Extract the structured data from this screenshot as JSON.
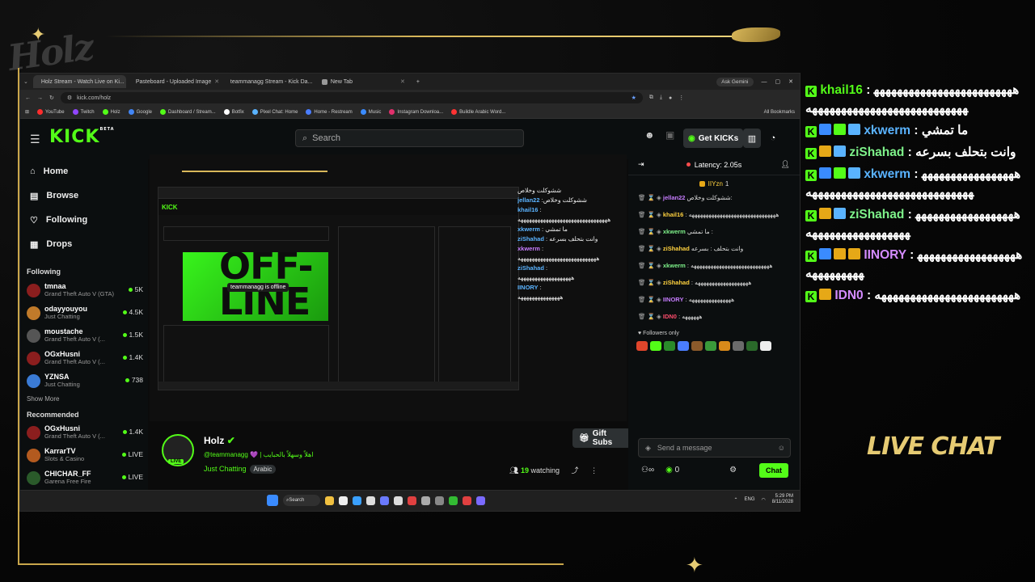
{
  "browser": {
    "tabs": [
      {
        "label": "Holz Stream - Watch Live on Ki...",
        "active": true,
        "color": "#53fc18"
      },
      {
        "label": "Pasteboard - Uploaded Image",
        "active": false,
        "color": "#6aa0ff"
      },
      {
        "label": "teammanagg Stream - Kick Da...",
        "active": false,
        "color": "#53fc18"
      },
      {
        "label": "New Tab",
        "active": false,
        "color": "#999999"
      }
    ],
    "ask_gemini": "Ask Gemini",
    "url": "kick.com/holz",
    "all_bookmarks": "All Bookmarks",
    "bookmarks": [
      {
        "label": "YouTube",
        "color": "#ff2d2d"
      },
      {
        "label": "Twitch",
        "color": "#9146ff"
      },
      {
        "label": "Holz",
        "color": "#53fc18"
      },
      {
        "label": "Google",
        "color": "#4285f4"
      },
      {
        "label": "Dashboard / Stream...",
        "color": "#53fc18"
      },
      {
        "label": "Botfix",
        "color": "#ffffff"
      },
      {
        "label": "Pixel Chat: Home",
        "color": "#5ab3ff"
      },
      {
        "label": "Home - Restream",
        "color": "#4a7dff"
      },
      {
        "label": "Music",
        "color": "#3a8bff"
      },
      {
        "label": "Instagram Downloa...",
        "color": "#e1306c"
      },
      {
        "label": "Buildle Arabic Word...",
        "color": "#ff3333"
      }
    ]
  },
  "kick": {
    "logo": "KICK",
    "beta": "BETA",
    "search_placeholder": "Search",
    "get_kicks": "Get KICKs",
    "nav": [
      {
        "label": "Home",
        "icon": "home-icon",
        "glyph": "⌂"
      },
      {
        "label": "Browse",
        "icon": "browse-icon",
        "glyph": "▤"
      },
      {
        "label": "Following",
        "icon": "heart-icon",
        "glyph": "♡"
      },
      {
        "label": "Drops",
        "icon": "drops-icon",
        "glyph": "▦"
      }
    ],
    "following_title": "Following",
    "following": [
      {
        "name": "tmnaa",
        "game": "Grand Theft Auto V (GTA)",
        "count": "5K",
        "color": "#8b1e1e"
      },
      {
        "name": "odayyouyou",
        "game": "Just Chatting",
        "count": "4.5K",
        "color": "#c07a2a"
      },
      {
        "name": "moustache",
        "game": "Grand Theft Auto V (...",
        "count": "1.5K",
        "color": "#555555"
      },
      {
        "name": "OGxHusni",
        "game": "Grand Theft Auto V (...",
        "count": "1.4K",
        "color": "#8b1e1e"
      },
      {
        "name": "YZNSA",
        "game": "Just Chatting",
        "count": "738",
        "color": "#3a7bd5"
      }
    ],
    "show_more": "Show More",
    "recommended_title": "Recommended",
    "recommended": [
      {
        "name": "OGxHusni",
        "game": "Grand Theft Auto V (...",
        "count": "1.4K",
        "color": "#8b1e1e"
      },
      {
        "name": "KarrarTV",
        "game": "Slots & Casino",
        "count": "LIVE",
        "color": "#b35a1f"
      },
      {
        "name": "CHICHAR_FF",
        "game": "Garena Free Fire",
        "count": "LIVE",
        "color": "#2a5a2a"
      }
    ],
    "channel": {
      "name": "Holz",
      "live": "LIVE",
      "handle": "@teammanagg 💜 | اهلاً وسهلاً بالحبايب",
      "category": "Just Chatting",
      "tag": "Arabic",
      "gift_subs": "Gift Subs",
      "watching_count": "19",
      "watching_label": "watching"
    },
    "inner": {
      "offline_text": "OFF-\nLINE",
      "offline_badge": "teammanagg is offline",
      "chat": [
        {
          "user": "",
          "text": "ششوكلت وخلاص"
        },
        {
          "user": "jellan22",
          "text": ":ششوكلت وخلاص"
        },
        {
          "user": "khail16",
          "text": ":"
        },
        {
          "user": "",
          "text": "ههههههههههههههههههههههههههههههههه"
        },
        {
          "user": "xkwerm",
          "text": ": ما تمشي"
        },
        {
          "user": "ziShahad",
          "text": ": وانت بتحلف بسرعه"
        },
        {
          "user": "xkwerm",
          "text": ":"
        },
        {
          "user": "",
          "text": "ههههههههههههههههههههههههههههه"
        },
        {
          "user": "ziShahad",
          "text": ":"
        },
        {
          "user": "",
          "text": "هههههههههههههههههههه"
        },
        {
          "user": "IINORY",
          "text": ":"
        },
        {
          "user": "",
          "text": "هههههههههههههههه"
        }
      ]
    },
    "chatpane": {
      "latency": "Latency: 2.05s",
      "pinned_user": "IIYzn",
      "pinned_count": "1",
      "messages": [
        {
          "user": "jellan22",
          "color": "#c77dff",
          "text": "ششوكلت وخلاص:"
        },
        {
          "user": "khail16",
          "color": "#ffd23f",
          "text": ": هههههههههههههههههههههههههههههههه"
        },
        {
          "user": "xkwerm",
          "color": "#7ef28a",
          "text": "ما تمشي :"
        },
        {
          "user": "ziShahad",
          "color": "#ffd23f",
          "text": "وانت بتحلف : بسرعه"
        },
        {
          "user": "xkwerm",
          "color": "#7ef28a",
          "text": ": ههههههههههههههههههههههههههههه"
        },
        {
          "user": "ziShahad",
          "color": "#ffd23f",
          "text": ": هههههههههههههههههههه"
        },
        {
          "user": "IINORY",
          "color": "#c77dff",
          "text": ": هههههههههههههههه"
        },
        {
          "user": "IDN0",
          "color": "#ff4d6d",
          "text": ": ههههههه"
        }
      ],
      "followers_only": "Followers only",
      "send_placeholder": "Send a message",
      "kicks_count": "0",
      "chat_button": "Chat"
    }
  },
  "taskbar": {
    "search": "Search",
    "lang": "ENG",
    "time": "5:29 PM",
    "date": "8/11/2028"
  },
  "overlay": {
    "messages": [
      {
        "user": "khail16",
        "name_class": "ol-name-a",
        "badges": [],
        "text": ": ههههههههههههههههههههههههههههههههههههههههههههههههههههه"
      },
      {
        "user": "xkwerm",
        "name_class": "ol-name-b",
        "badges": [
          "#3a8bff",
          "#53fc18",
          "#5ab3ff"
        ],
        "text": ": ما تمشي"
      },
      {
        "user": "ziShahad",
        "name_class": "ol-name-c",
        "badges": [
          "#e6a817",
          "#5ab3ff"
        ],
        "text": ": وانت بتحلف بسرعه"
      },
      {
        "user": "xkwerm",
        "name_class": "ol-name-b",
        "badges": [
          "#3a8bff",
          "#53fc18",
          "#5ab3ff"
        ],
        "text": ": هههههههههههههههههههههههههههههههههههههههههههههه"
      },
      {
        "user": "ziShahad",
        "name_class": "ol-name-c",
        "badges": [
          "#e6a817",
          "#5ab3ff"
        ],
        "text": ": هههههههههههههههههههههههههههههههههههه"
      },
      {
        "user": "IINORY",
        "name_class": "ol-name-d",
        "badges": [
          "#3a8bff",
          "#e6a817",
          "#e6a817"
        ],
        "text": ": هههههههههههههههههههههههههههه"
      },
      {
        "user": "IDN0",
        "name_class": "ol-name-d",
        "badges": [
          "#e6a817"
        ],
        "text": ": ههههههههههههههههههههههههه"
      }
    ],
    "live_chat": "LIVE CHAT"
  }
}
